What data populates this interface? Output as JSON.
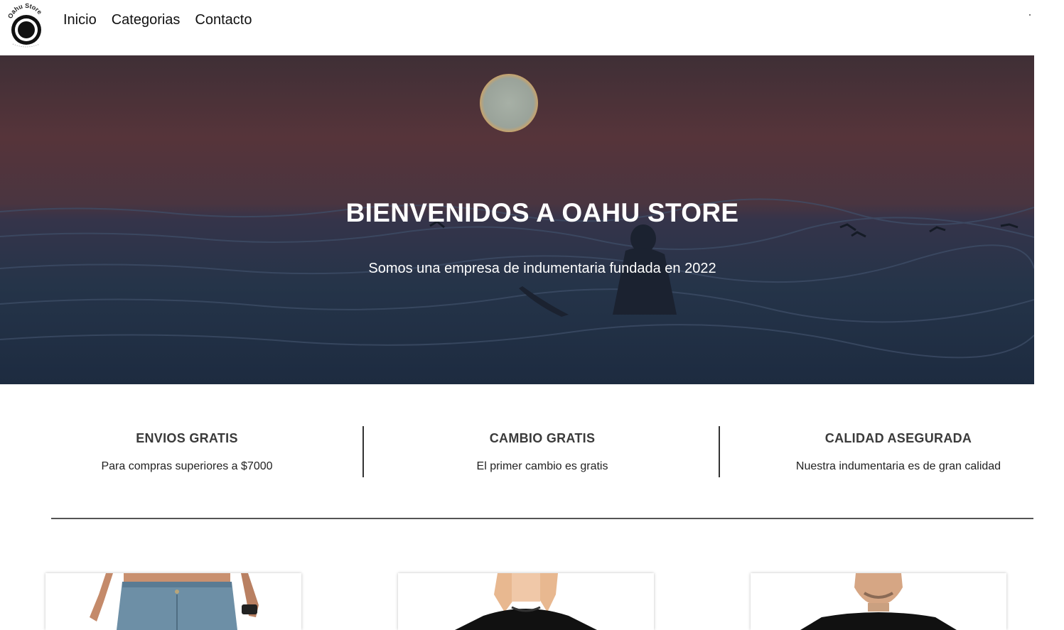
{
  "brand": {
    "logo_text": "Oahu Store"
  },
  "nav": {
    "items": [
      "Inicio",
      "Categorias",
      "Contacto"
    ]
  },
  "hero": {
    "title": "BIENVENIDOS A OAHU STORE",
    "subtitle": "Somos una empresa de indumentaria fundada en 2022"
  },
  "features": [
    {
      "title": "ENVIOS GRATIS",
      "text": "Para compras superiores a $7000"
    },
    {
      "title": "CAMBIO GRATIS",
      "text": "El primer cambio es gratis"
    },
    {
      "title": "CALIDAD ASEGURADA",
      "text": "Nuestra indumentaria es de gran calidad"
    }
  ],
  "products": [
    {
      "image": "jeans-product-image"
    },
    {
      "image": "black-tshirt-woman-product-image"
    },
    {
      "image": "black-tshirt-man-product-image"
    }
  ],
  "colors": {
    "accent": "#ffffff",
    "text": "#3a3a3a",
    "divider": "#555555"
  }
}
